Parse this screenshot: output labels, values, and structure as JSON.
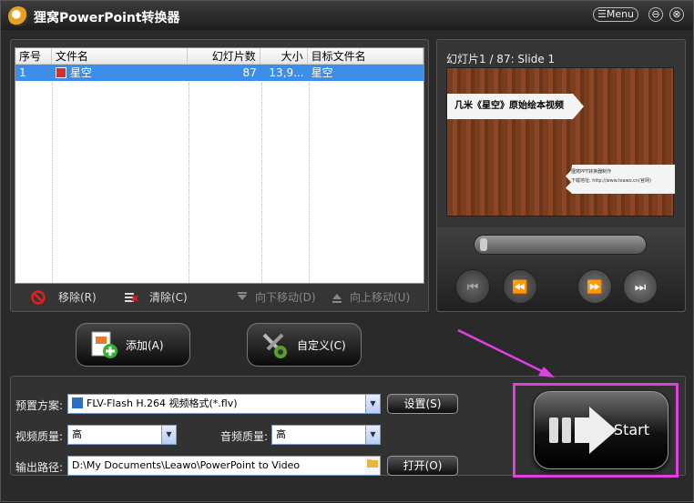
{
  "app": {
    "title": "狸窝PowerPoint转换器",
    "menu": "Menu",
    "minimize": "⊖",
    "close": "⊗"
  },
  "list": {
    "headers": [
      "序号",
      "文件名",
      "幻灯片数",
      "大小",
      "目标文件名"
    ],
    "rows": [
      {
        "index": "1",
        "file": "星空",
        "slides": "87",
        "size": "13,9...",
        "target": "星空"
      }
    ]
  },
  "list_buttons": {
    "remove": "移除(R)",
    "clear": "清除(C)",
    "move_down": "向下移动(D)",
    "move_up": "向上移动(U)"
  },
  "preview": {
    "label": "幻灯片1 / 87: Slide 1",
    "slide_title": "几米《星空》原始绘本视频",
    "note_line1": "狸窝PPT转换器制作",
    "note_line2": "下载地址: http://www.leawo.cn(官网)"
  },
  "actions": {
    "add": "添加(A)",
    "customize": "自定义(C)"
  },
  "settings": {
    "preset_label": "预置方案:",
    "preset_value": "FLV-Flash H.264 视频格式(*.flv)",
    "settings_button": "设置(S)",
    "video_quality_label": "视频质量:",
    "video_quality_value": "高",
    "audio_quality_label": "音频质量:",
    "audio_quality_value": "高",
    "output_label": "输出路径:",
    "output_value": "D:\\My Documents\\Leawo\\PowerPoint to Video",
    "open_button": "打开(O)"
  },
  "start": {
    "label": "Start"
  },
  "colors": {
    "highlight": "#e040e0",
    "selection": "#3d8ee8"
  }
}
